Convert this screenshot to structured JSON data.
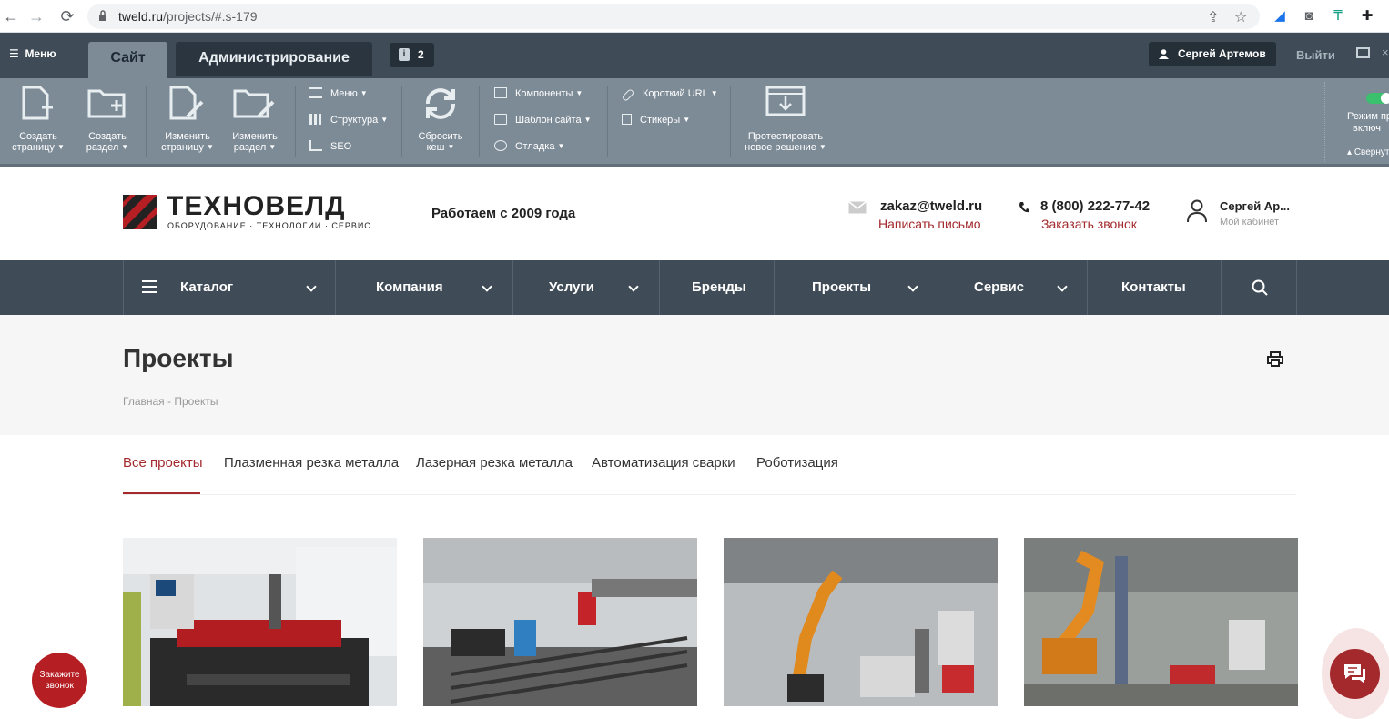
{
  "browser": {
    "url_host": "tweld.ru",
    "url_path": "/projects/#.s-179"
  },
  "admin_panel": {
    "menu_label": "Меню",
    "tab_site": "Сайт",
    "tab_admin": "Администрирование",
    "notifications_count": "2",
    "user_name": "Сергей Артемов",
    "logout": "Выйти",
    "toolbar": {
      "create_page": [
        "Создать",
        "страницу"
      ],
      "create_section": [
        "Создать",
        "раздел"
      ],
      "edit_page": [
        "Изменить",
        "страницу"
      ],
      "edit_section": [
        "Изменить",
        "раздел"
      ],
      "menu": "Меню",
      "structure": "Структура",
      "seo": "SEO",
      "reset_cache": [
        "Сбросить",
        "кеш"
      ],
      "components": "Компоненты",
      "site_template": "Шаблон сайта",
      "debug": "Отладка",
      "short_url": "Короткий URL",
      "stickers": "Стикеры",
      "test_solution": [
        "Протестировать",
        "новое решение"
      ],
      "mode_label": [
        "Режим пр",
        "включ"
      ],
      "collapse": "Свернуть"
    }
  },
  "header": {
    "logo_text": "ТЕХНОВЕЛД",
    "logo_tagline": "ОБОРУДОВАНИЕ · ТЕХНОЛОГИИ · СЕРВИС",
    "since": "Работаем с 2009 года",
    "email": "zakaz@tweld.ru",
    "email_link": "Написать письмо",
    "phone": "8 (800) 222-77-42",
    "call_link": "Заказать звонок",
    "user_name": "Сергей Ар...",
    "cabinet": "Мой кабинет"
  },
  "nav": {
    "catalog": "Каталог",
    "company": "Компания",
    "services": "Услуги",
    "brands": "Бренды",
    "projects": "Проекты",
    "service": "Сервис",
    "contacts": "Контакты"
  },
  "page": {
    "title": "Проекты",
    "crumb_home": "Главная",
    "crumb_sep": "-",
    "crumb_current": "Проекты"
  },
  "filters": {
    "all": "Все проекты",
    "plasma": "Плазменная резка металла",
    "laser": "Лазерная резка металла",
    "automation": "Автоматизация сварки",
    "robotics": "Роботизация"
  },
  "floating": {
    "callback": [
      "Закажите",
      "звонок"
    ]
  },
  "colors": {
    "accent": "#a3292d",
    "nav_bg": "#3f4b57",
    "admin_toolbar": "#7d8b97"
  }
}
